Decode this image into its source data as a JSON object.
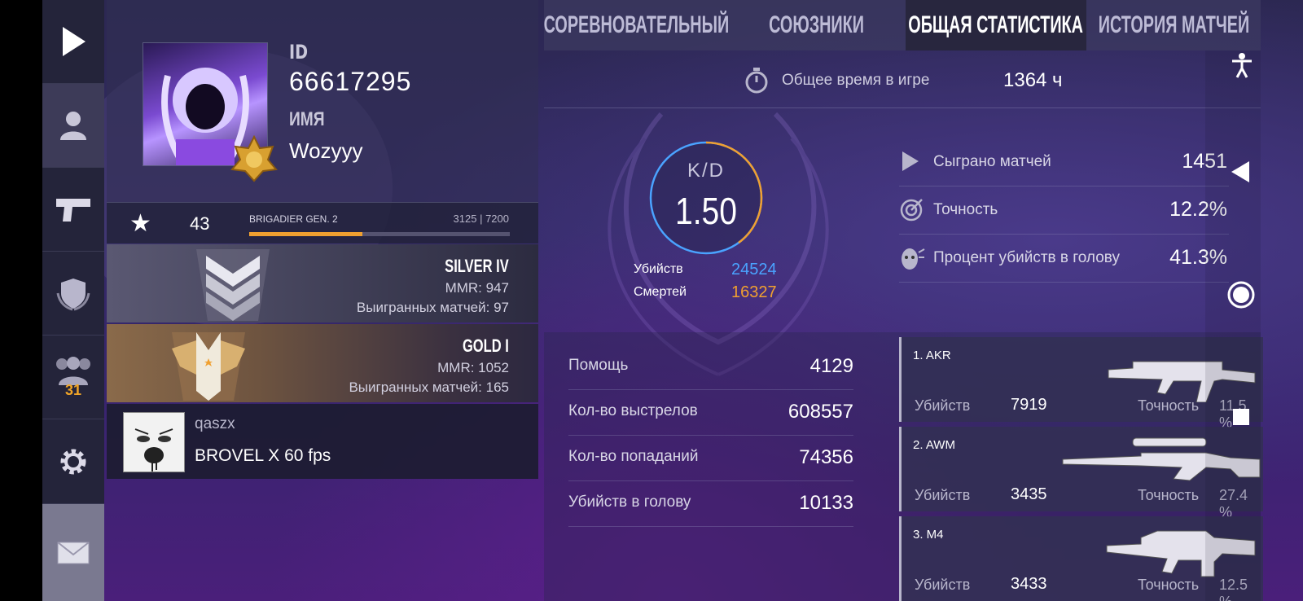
{
  "sidebar": {
    "friends_count": "31"
  },
  "profile": {
    "id_label": "ID",
    "id_value": "66617295",
    "name_label": "ИМЯ",
    "name_value": "Wozyyy"
  },
  "level": {
    "value": "43",
    "rank_name": "BRIGADIER GEN. 2",
    "xp_text": "3125 | 7200",
    "xp_fraction": 0.434
  },
  "ranks": [
    {
      "title": "SILVER IV",
      "mmr": "MMR: 947",
      "wins": "Выигранных матчей: 97"
    },
    {
      "title": "GOLD I",
      "mmr": "MMR: 1052",
      "wins": "Выигранных матчей: 165"
    }
  ],
  "clan": {
    "name": "qaszx",
    "description": "BROVEL X 60 fps"
  },
  "tabs": [
    {
      "label": "СОРЕВНОВАТЕЛЬНЫЙ"
    },
    {
      "label": "СОЮЗНИКИ"
    },
    {
      "label": "ОБЩАЯ СТАТИСТИКА"
    },
    {
      "label": "ИСТОРИЯ МАТЧЕЙ"
    }
  ],
  "active_tab": "ОБЩАЯ СТАТИСТИКА",
  "playtime": {
    "label": "Общее время в игре",
    "value": "1364 ч"
  },
  "kd": {
    "label": "K/D",
    "value": "1.50",
    "kills_label": "Убийств",
    "kills_value": "24524",
    "deaths_label": "Смертей",
    "deaths_value": "16327",
    "kills_fraction": 0.6
  },
  "stats": [
    {
      "label": "Сыграно матчей",
      "value": "1451",
      "icon": "play-icon"
    },
    {
      "label": "Точность",
      "value": "12.2%",
      "icon": "target-icon"
    },
    {
      "label": "Процент убийств в голову",
      "value": "41.3%",
      "icon": "headshot-icon"
    }
  ],
  "misc_stats": [
    {
      "label": "Помощь",
      "value": "4129"
    },
    {
      "label": "Кол-во выстрелов",
      "value": "608557"
    },
    {
      "label": "Кол-во попаданий",
      "value": "74356"
    },
    {
      "label": "Убийств в голову",
      "value": "10133"
    }
  ],
  "weapons": [
    {
      "name": "1. AKR",
      "kills_label": "Убийств",
      "kills": "7919",
      "acc_label": "Точность",
      "acc": "11.5 %"
    },
    {
      "name": "2. AWM",
      "kills_label": "Убийств",
      "kills": "3435",
      "acc_label": "Точность",
      "acc": "27.4 %"
    },
    {
      "name": "3. M4",
      "kills_label": "Убийств",
      "kills": "3433",
      "acc_label": "Точность",
      "acc": "12.5 %"
    }
  ],
  "colors": {
    "accent_orange": "#f0a030",
    "kills_blue": "#4aa3ff",
    "sidebar_bg": "#24243a"
  }
}
